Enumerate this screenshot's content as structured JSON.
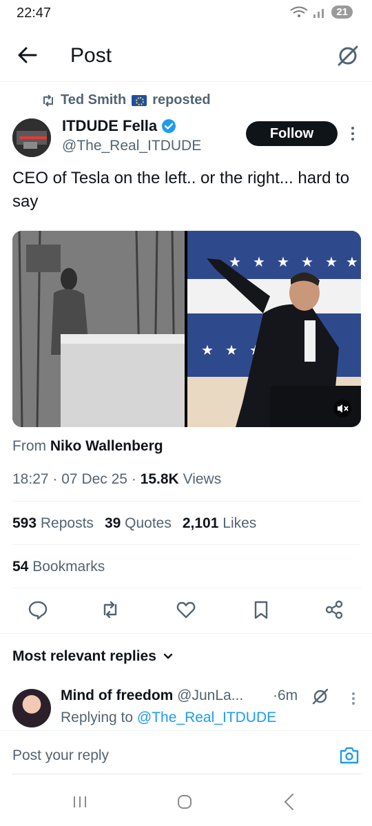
{
  "status_bar": {
    "time": "22:47",
    "battery": "21"
  },
  "header": {
    "title": "Post"
  },
  "repost": {
    "by": "Ted Smith",
    "suffix": "reposted"
  },
  "author": {
    "name": "ITDUDE Fella",
    "handle": "@The_Real_ITDUDE"
  },
  "follow_label": "Follow",
  "tweet": {
    "text": "CEO of Tesla on the left.. or the right... hard to say"
  },
  "from": {
    "prefix": "From",
    "name": "Niko Wallenberg"
  },
  "meta": {
    "time": "18:27",
    "date": "07 Dec 25",
    "views_count": "15.8K",
    "views_label": "Views"
  },
  "stats": {
    "reposts_count": "593",
    "reposts_label": "Reposts",
    "quotes_count": "39",
    "quotes_label": "Quotes",
    "likes_count": "2,101",
    "likes_label": "Likes",
    "bookmarks_count": "54",
    "bookmarks_label": "Bookmarks"
  },
  "actions": [
    "reply-icon",
    "repost-icon",
    "like-icon",
    "bookmark-icon",
    "share-icon"
  ],
  "replies": {
    "header": "Most relevant replies",
    "first": {
      "name": "Mind of freedom",
      "handle": "@JunLa...",
      "time": "·6m",
      "replying_prefix": "Replying to",
      "replying_handle": "@The_Real_ITDUDE"
    }
  },
  "composer": {
    "placeholder": "Post your reply"
  },
  "colors": {
    "accent": "#1d9bf0",
    "text": "#0f1419",
    "muted": "#536471"
  }
}
